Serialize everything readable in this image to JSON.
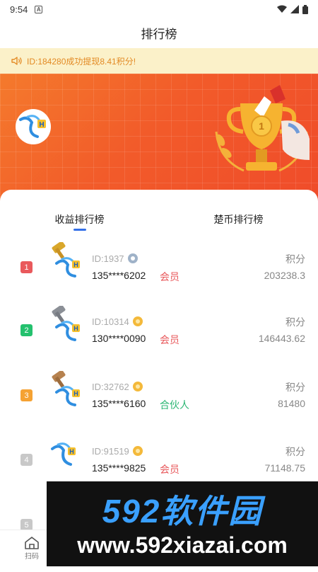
{
  "status": {
    "time": "9:54",
    "a_label": "A"
  },
  "header": {
    "title": "排行榜"
  },
  "notice": {
    "text": "ID:184280成功提现8.41积分!"
  },
  "tabs": [
    {
      "label": "收益排行榜",
      "active": true
    },
    {
      "label": "楚币排行榜",
      "active": false
    }
  ],
  "rows": [
    {
      "rank": "1",
      "id": "ID:1937",
      "phone": "135****6202",
      "level": "会员",
      "points_label": "积分",
      "points": "203238.3"
    },
    {
      "rank": "2",
      "id": "ID:10314",
      "phone": "130****0090",
      "level": "会员",
      "points_label": "积分",
      "points": "146443.62"
    },
    {
      "rank": "3",
      "id": "ID:32762",
      "phone": "135****6160",
      "level": "合伙人",
      "points_label": "积分",
      "points": "81480"
    },
    {
      "rank": "4",
      "id": "ID:91519",
      "phone": "135****9825",
      "level": "会员",
      "points_label": "积分",
      "points": "71148.75"
    },
    {
      "rank": "5"
    }
  ],
  "bottom_nav": {
    "scan_label": "扫码"
  },
  "watermark": {
    "brand": "592软件园",
    "url": "www.592xiazai.com"
  },
  "colors": {
    "accent": "#3470e8",
    "rank1": "#e9595c",
    "rank2": "#24c16e",
    "rank3": "#f5a233",
    "rank_other": "#c8c8c8",
    "member": "#e8585b",
    "partner": "#2bb673",
    "notice_bg": "#fbf1c9",
    "notice_text": "#e38a24"
  }
}
